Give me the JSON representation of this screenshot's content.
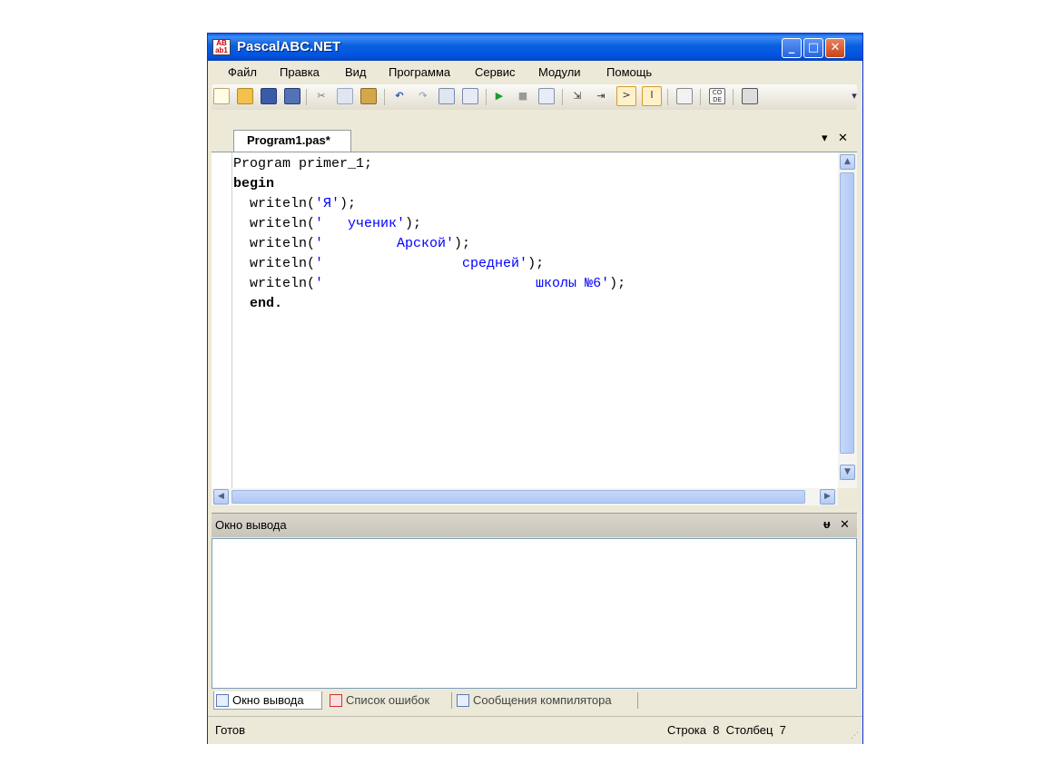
{
  "window": {
    "title": "PascalABC.NET",
    "app_icon_text": "AB ab1"
  },
  "title_buttons": {
    "minimize": "_",
    "maximize": "□",
    "close": "✕"
  },
  "menu": [
    "Файл",
    "Правка",
    "Вид",
    "Программа",
    "Сервис",
    "Модули",
    "Помощь"
  ],
  "toolbar": {
    "icons": [
      "new-icon",
      "open-icon",
      "save-icon",
      "save-all-icon",
      "cut-icon",
      "copy-icon",
      "paste-icon",
      "undo-icon",
      "redo-icon",
      "compile-icon",
      "build-icon",
      "run-icon",
      "stop-icon",
      "debug-icon",
      "step-over-icon",
      "step-into-icon",
      "output-panel-icon",
      "format-icon",
      "comment-icon",
      "code-icon",
      "properties-icon"
    ]
  },
  "editor_tab": {
    "label": "Program1.pas*",
    "dropdown": "▾",
    "close": "✕"
  },
  "code": [
    {
      "parts": [
        {
          "t": "Program primer_1;",
          "c": "plain"
        }
      ]
    },
    {
      "parts": [
        {
          "t": "begin",
          "c": "kw"
        }
      ]
    },
    {
      "parts": [
        {
          "t": "  writeln(",
          "c": "plain"
        },
        {
          "t": "'Я'",
          "c": "str"
        },
        {
          "t": ");",
          "c": "plain"
        }
      ]
    },
    {
      "parts": [
        {
          "t": "  writeln(",
          "c": "plain"
        },
        {
          "t": "'   ученик'",
          "c": "str"
        },
        {
          "t": ");",
          "c": "plain"
        }
      ]
    },
    {
      "parts": [
        {
          "t": "  writeln(",
          "c": "plain"
        },
        {
          "t": "'         Арской'",
          "c": "str"
        },
        {
          "t": ");",
          "c": "plain"
        }
      ]
    },
    {
      "parts": [
        {
          "t": "  writeln(",
          "c": "plain"
        },
        {
          "t": "'                 средней'",
          "c": "str"
        },
        {
          "t": ");",
          "c": "plain"
        }
      ]
    },
    {
      "parts": [
        {
          "t": "  writeln(",
          "c": "plain"
        },
        {
          "t": "'                          школы №6'",
          "c": "str"
        },
        {
          "t": ");",
          "c": "plain"
        }
      ]
    },
    {
      "parts": [
        {
          "t": "  end.",
          "c": "kw"
        }
      ]
    }
  ],
  "output_panel": {
    "title": "Окно вывода",
    "pin": "ᵾ",
    "close": "✕"
  },
  "bottom_tabs": [
    "Окно вывода",
    "Список ошибок",
    "Сообщения компилятора"
  ],
  "status": {
    "left": "Готов",
    "position": "Строка  8  Столбец  7"
  },
  "colors": {
    "title_bar": "#0a5fde",
    "string": "#0000ff",
    "keyword": "#000000",
    "chrome": "#ece9d8"
  }
}
